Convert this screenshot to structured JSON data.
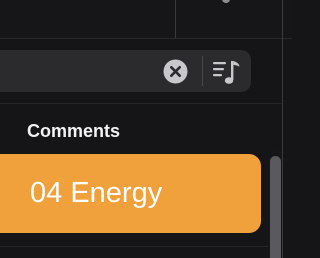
{
  "toolbar": {
    "search_value": "",
    "search_placeholder": "",
    "clear_icon": "x-circle-icon",
    "playlist_icon": "playlist-note-icon"
  },
  "list": {
    "section_title": "Comments",
    "items": [
      {
        "label": "04 Energy",
        "selected": true
      }
    ]
  },
  "colors": {
    "background": "#151517",
    "search_field": "#2b2b2e",
    "selected_row": "#f1a13c",
    "text_primary": "#ffffff",
    "icon_gray": "#c7c7cc"
  }
}
